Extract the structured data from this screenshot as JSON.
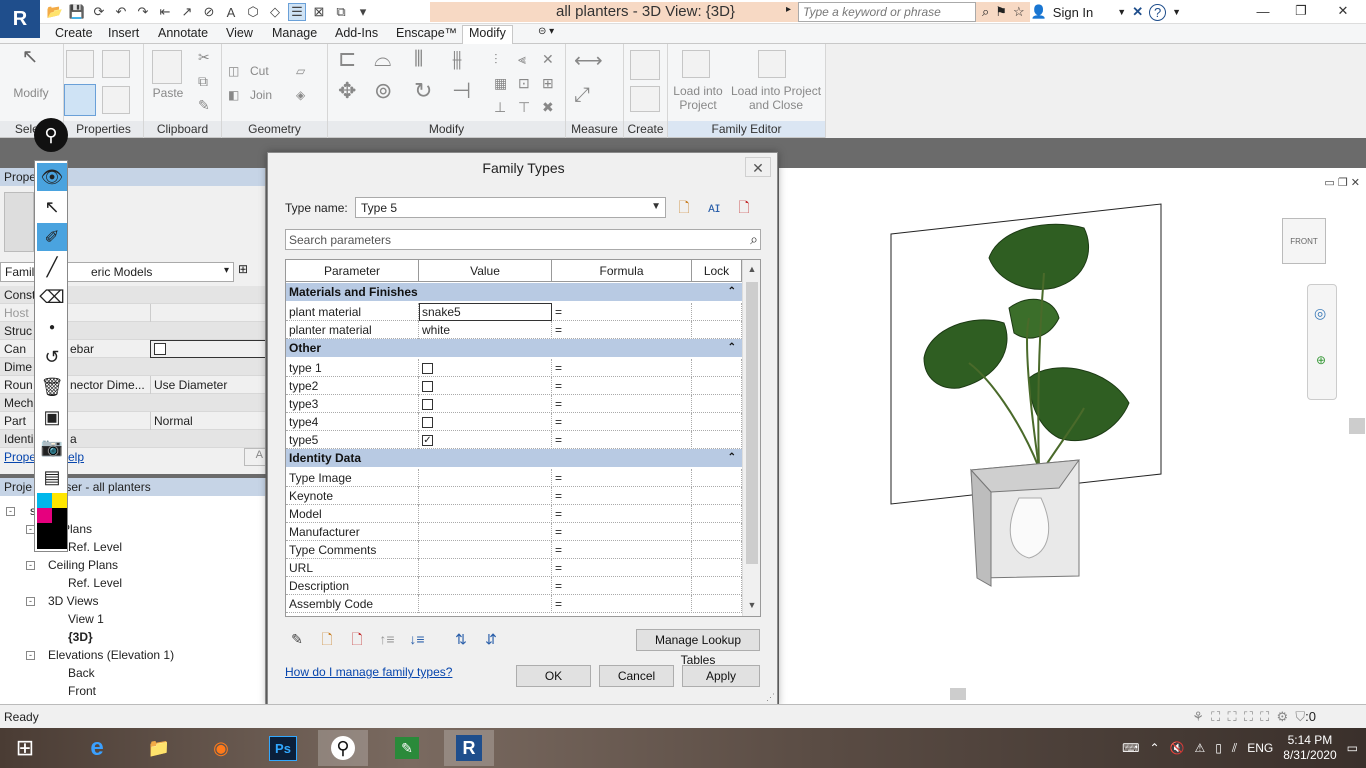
{
  "app": {
    "logo": "R",
    "document_title": "all planters - 3D View: {3D}"
  },
  "titlebar": {
    "search_placeholder": "Type a keyword or phrase",
    "sign_in": "Sign In",
    "help": "?"
  },
  "ribbon": {
    "tabs": [
      "Create",
      "Insert",
      "Annotate",
      "View",
      "Manage",
      "Add-Ins",
      "Enscape™",
      "Modify"
    ],
    "active_tab": "Modify",
    "buttons": {
      "modify": "Modify",
      "paste": "Paste",
      "cut": "Cut",
      "join": "Join",
      "load_into_project": "Load into Project",
      "load_into_project_close": "Load into Project and Close"
    },
    "panels": {
      "select": "Select",
      "properties": "Properties",
      "clipboard": "Clipboard",
      "geometry": "Geometry",
      "modify": "Modify",
      "measure": "Measure",
      "create": "Create",
      "family_editor": "Family Editor"
    }
  },
  "properties": {
    "header": "Prope",
    "family_combo": "eric Models",
    "family_prefix": "Famil",
    "rows": [
      {
        "label": "Const",
        "group": true
      },
      {
        "label": "Host",
        "value": "",
        "muted": true
      },
      {
        "label": "Struc",
        "group": true
      },
      {
        "label": "Can",
        "mid": "ebar",
        "checkbox": true
      },
      {
        "label": "Dime",
        "group": true
      },
      {
        "label": "Roun",
        "mid": "nector Dime...",
        "value": "Use Diameter"
      },
      {
        "label": "Mech",
        "group": true
      },
      {
        "label": "Part",
        "value": "Normal"
      },
      {
        "label": "Identi",
        "mid": "a",
        "group": true
      }
    ],
    "footer_link": "Prope",
    "footer_link2": "elp",
    "apply": "A"
  },
  "browser": {
    "header": "Proje          ser - all planters",
    "items": [
      {
        "text": "s (all)",
        "level": 0,
        "toggle": "-"
      },
      {
        "text": "or Plans",
        "level": 1,
        "toggle": "-"
      },
      {
        "text": "Ref. Level",
        "level": 2
      },
      {
        "text": "Ceiling Plans",
        "level": 1,
        "toggle": "-"
      },
      {
        "text": "Ref. Level",
        "level": 2
      },
      {
        "text": "3D Views",
        "level": 1,
        "toggle": "-"
      },
      {
        "text": "View 1",
        "level": 2
      },
      {
        "text": "{3D}",
        "level": 2,
        "selected": true
      },
      {
        "text": "Elevations (Elevation 1)",
        "level": 1,
        "toggle": "-"
      },
      {
        "text": "Back",
        "level": 2
      },
      {
        "text": "Front",
        "level": 2
      }
    ]
  },
  "dialog": {
    "title": "Family Types",
    "type_name_label": "Type name:",
    "type_name": "Type 5",
    "search_placeholder": "Search parameters",
    "columns": [
      "Parameter",
      "Value",
      "Formula",
      "Lock"
    ],
    "groups": [
      {
        "name": "Materials and Finishes",
        "rows": [
          {
            "param": "plant material",
            "value": "snake5",
            "formula": "=",
            "editing": true
          },
          {
            "param": "planter material",
            "value": "white",
            "formula": "="
          }
        ]
      },
      {
        "name": "Other",
        "rows": [
          {
            "param": "type 1",
            "check": false,
            "formula": "="
          },
          {
            "param": "type2",
            "check": false,
            "formula": "="
          },
          {
            "param": "type3",
            "check": false,
            "formula": "="
          },
          {
            "param": "type4",
            "check": false,
            "formula": "="
          },
          {
            "param": "type5",
            "check": true,
            "formula": "="
          }
        ]
      },
      {
        "name": "Identity Data",
        "rows": [
          {
            "param": "Type Image",
            "value": "",
            "formula": "="
          },
          {
            "param": "Keynote",
            "value": "",
            "formula": "="
          },
          {
            "param": "Model",
            "value": "",
            "formula": "="
          },
          {
            "param": "Manufacturer",
            "value": "",
            "formula": "="
          },
          {
            "param": "Type Comments",
            "value": "",
            "formula": "="
          },
          {
            "param": "URL",
            "value": "",
            "formula": "="
          },
          {
            "param": "Description",
            "value": "",
            "formula": "="
          },
          {
            "param": "Assembly Code",
            "value": "",
            "formula": "="
          }
        ]
      }
    ],
    "manage_lookup": "Manage Lookup Tables",
    "help_link": "How do I manage family types?",
    "ok": "OK",
    "cancel": "Cancel",
    "apply": "Apply"
  },
  "view3d": {
    "viewcube_label": "FRONT"
  },
  "status": {
    "text": "Ready",
    "filter_count": ":0"
  },
  "taskbar": {
    "lang": "ENG",
    "time": "5:14 PM",
    "date": "8/31/2020"
  },
  "colors": {
    "accent": "#1f4e8c",
    "group_header": "#b8cae3",
    "toolbar_highlight": "#4aa3df"
  }
}
